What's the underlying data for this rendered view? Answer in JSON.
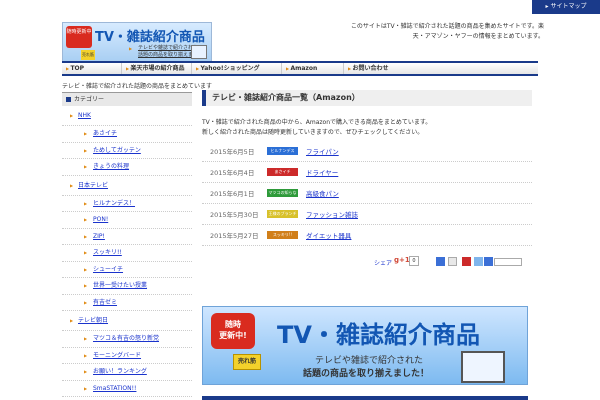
{
  "topbar": {
    "sitemap": "サイトマップ"
  },
  "logo": {
    "badge": "随時更新中",
    "title": "TV・雑誌紹介商品",
    "sub_line1": "テレビや雑誌で紹介された",
    "sub_line2": "話題の商品を取り揃えました",
    "tag": "売れ筋"
  },
  "intro": "このサイトはTV・雑誌で紹介された話題の商品を集めたサイトです。楽天・アマゾン・ヤフーの情報をまとめています。",
  "nav": {
    "items": [
      {
        "label": "TOP"
      },
      {
        "label": "楽天市場の紹介商品"
      },
      {
        "label": "Yahoo!ショッピング"
      },
      {
        "label": "Amazon"
      },
      {
        "label": "お問い合わせ"
      }
    ]
  },
  "tagline": "テレビ・雑誌で紹介された話題の商品をまとめています",
  "sidebar": {
    "heading": "カテゴリー",
    "groups": [
      {
        "label": "NHK",
        "children": [
          "あさイチ",
          "ためしてガッテン",
          "きょうの料理"
        ]
      },
      {
        "label": "日本テレビ",
        "children": [
          "ヒルナンデス！",
          "PON!",
          "ZIP!",
          "スッキリ!!",
          "シューイチ",
          "世界一受けたい授業",
          "有吉ゼミ"
        ]
      },
      {
        "label": "テレビ朝日",
        "children": [
          "マツコ＆有吉の怒り新党",
          "モーニングバード",
          "お願い！ランキング",
          "SmaSTATION!!"
        ]
      }
    ]
  },
  "main": {
    "title": "テレビ・雑誌紹介商品一覧（Amazon）",
    "desc_line1": "TV・雑誌で紹介された商品の中から、Amazonで購入できる商品をまとめています。",
    "desc_line2": "新しく紹介された商品は随時更新していきますので、ぜひチェックしてください。",
    "news": [
      {
        "date": "2015年6月5日",
        "label": "ヒルナンデス",
        "link": "フライパン",
        "color": "#2b6fd6"
      },
      {
        "date": "2015年6月4日",
        "label": "あさイチ",
        "link": "ドライヤー",
        "color": "#cc2a2a"
      },
      {
        "date": "2015年6月1日",
        "label": "マツコの知らない",
        "link": "高級食パン",
        "color": "#2e9a3a"
      },
      {
        "date": "2015年5月30日",
        "label": "王様のブランチ",
        "link": "ファッション雑誌",
        "color": "#d8c12b"
      },
      {
        "date": "2015年5月27日",
        "label": "スッキリ!!",
        "link": "ダイエット器具",
        "color": "#d17f1a"
      }
    ]
  },
  "social": {
    "share": "シェア",
    "gplus": "g+1",
    "count": "0"
  },
  "banner": {
    "badge_line1": "随時",
    "badge_line2": "更新中!",
    "title": "TV・雑誌紹介商品",
    "tag": "売れ筋",
    "line1": "テレビや雑誌で紹介された",
    "line2": "話題の商品を取り揃えました！"
  }
}
